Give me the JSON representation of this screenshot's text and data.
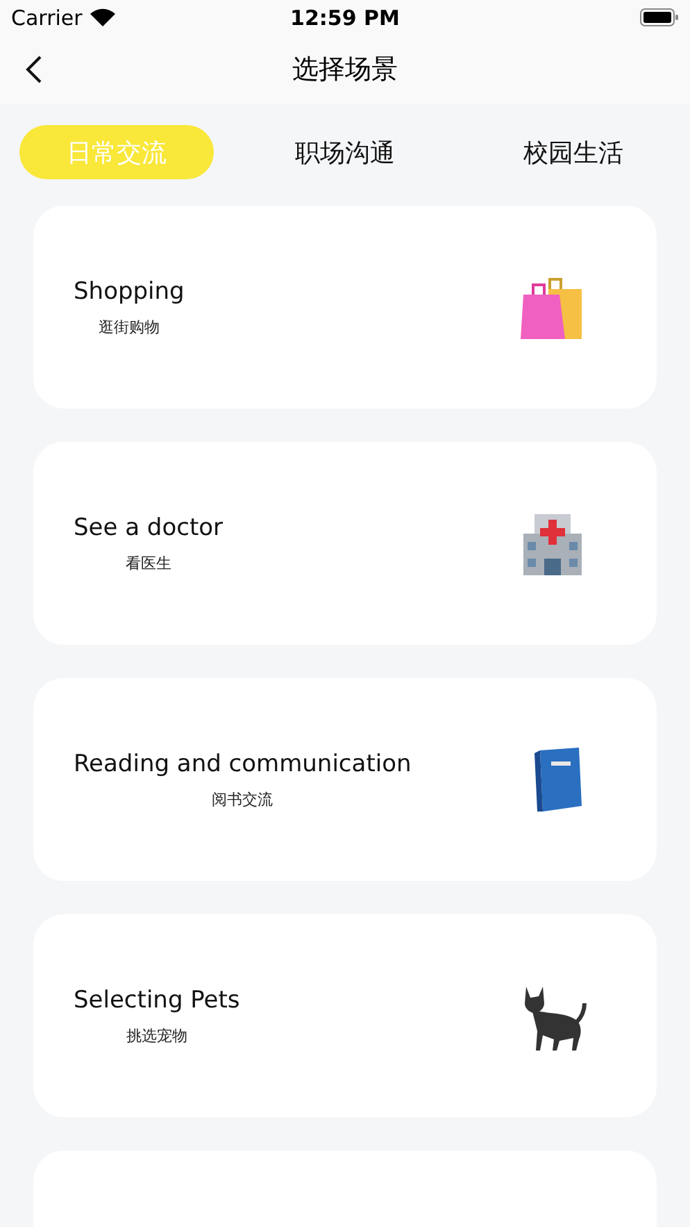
{
  "status_bar": {
    "carrier": "Carrier",
    "time": "12:59 PM"
  },
  "nav": {
    "title": "选择场景"
  },
  "tabs": [
    {
      "label": "日常交流",
      "selected": true
    },
    {
      "label": "职场沟通",
      "selected": false
    },
    {
      "label": "校园生活",
      "selected": false
    }
  ],
  "scenes": [
    {
      "title": "Shopping",
      "subtitle": "逛街购物"
    },
    {
      "title": "See a doctor",
      "subtitle": "看医生"
    },
    {
      "title": "Reading and communication",
      "subtitle": "阅书交流"
    },
    {
      "title": "Selecting Pets",
      "subtitle": "挑选宠物"
    }
  ]
}
